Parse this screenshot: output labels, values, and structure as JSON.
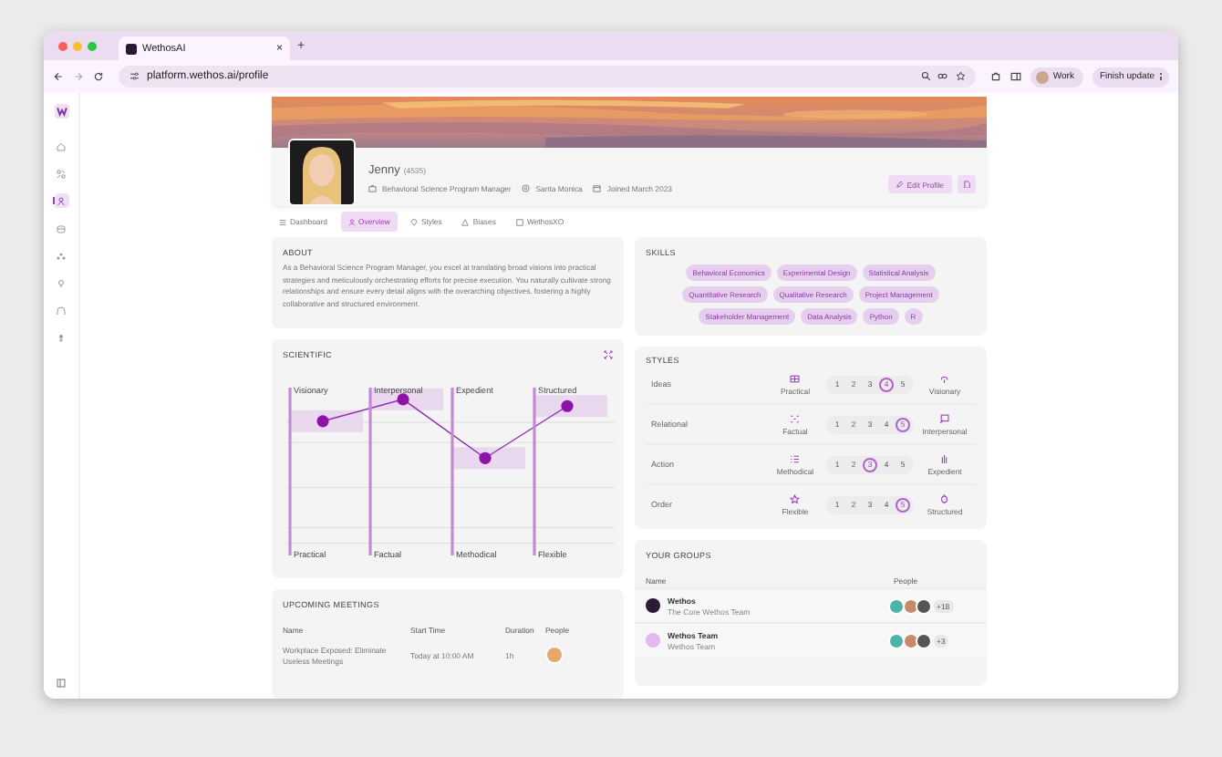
{
  "browser": {
    "tab_title": "WethosAI",
    "tab_close": "×",
    "new_tab": "+",
    "url": "platform.wethos.ai/profile",
    "profile_label": "Work",
    "update_button": "Finish update"
  },
  "sidebar": {
    "items": [
      {
        "selected": false
      },
      {
        "selected": false
      },
      {
        "selected": true
      },
      {
        "selected": false
      },
      {
        "selected": false
      },
      {
        "selected": false
      },
      {
        "selected": false
      },
      {
        "selected": false
      }
    ]
  },
  "profile": {
    "name": "Jenny",
    "handle": "(4535)",
    "title": "Behavioral Science Program Manager",
    "location": "Santa Monica",
    "joined": "Joined March 2023",
    "edit_button": "Edit Profile"
  },
  "tabs": [
    {
      "label": "Dashboard",
      "selected": false
    },
    {
      "label": "Overview",
      "selected": true
    },
    {
      "label": "Styles",
      "selected": false
    },
    {
      "label": "Biases",
      "selected": false
    },
    {
      "label": "WethosXO",
      "selected": false
    }
  ],
  "about": {
    "heading": "ABOUT",
    "text": "As a Behavioral Science Program Manager, you excel at translating broad visions into practical strategies and meticulously orchestrating efforts for precise execution. You naturally cultivate strong relationships and ensure every detail aligns with the overarching objectives, fostering a highly collaborative and structured environment."
  },
  "scientific": {
    "heading": "SCIENTIFIC",
    "axes": [
      {
        "top": "Visionary",
        "bottom": "Practical",
        "level": 0.8
      },
      {
        "top": "Interpersonal",
        "bottom": "Factual",
        "level": 0.93
      },
      {
        "top": "Expedient",
        "bottom": "Methodical",
        "level": 0.58
      },
      {
        "top": "Structured",
        "bottom": "Flexible",
        "level": 0.89
      }
    ]
  },
  "skills": {
    "heading": "SKILLS",
    "tags": [
      "Behavioral Economics",
      "Experimental Design",
      "Statistical Analysis",
      "Quantitative Research",
      "Qualitative Research",
      "Project Management",
      "Stakeholder Management",
      "Data Analysis",
      "Python",
      "R"
    ]
  },
  "styles": {
    "heading": "STYLES",
    "rows": [
      {
        "label": "Ideas",
        "left": "Practical",
        "right": "Visionary",
        "scale": [
          {
            "label": "1",
            "selected": false
          },
          {
            "label": "2",
            "selected": false
          },
          {
            "label": "3",
            "selected": false
          },
          {
            "label": "4",
            "selected": true
          },
          {
            "label": "5",
            "selected": false
          }
        ]
      },
      {
        "label": "Relational",
        "left": "Factual",
        "right": "Interpersonal",
        "scale": [
          {
            "label": "1",
            "selected": false
          },
          {
            "label": "2",
            "selected": false
          },
          {
            "label": "3",
            "selected": false
          },
          {
            "label": "4",
            "selected": false
          },
          {
            "label": "5",
            "selected": true
          }
        ]
      },
      {
        "label": "Action",
        "left": "Methodical",
        "right": "Expedient",
        "scale": [
          {
            "label": "1",
            "selected": false
          },
          {
            "label": "2",
            "selected": false
          },
          {
            "label": "3",
            "selected": true
          },
          {
            "label": "4",
            "selected": false
          },
          {
            "label": "5",
            "selected": false
          }
        ]
      },
      {
        "label": "Order",
        "left": "Flexible",
        "right": "Structured",
        "scale": [
          {
            "label": "1",
            "selected": false
          },
          {
            "label": "2",
            "selected": false
          },
          {
            "label": "3",
            "selected": false
          },
          {
            "label": "4",
            "selected": false
          },
          {
            "label": "5",
            "selected": true
          }
        ]
      }
    ]
  },
  "groups": {
    "heading": "YOUR GROUPS",
    "columns": [
      "Name",
      "People"
    ],
    "rows": [
      {
        "name": "Wethos",
        "subtitle": "The Core Wethos Team",
        "extra": "+18"
      },
      {
        "name": "Wethos Team",
        "subtitle": "Wethos Team",
        "extra": "+3"
      }
    ]
  },
  "meetings": {
    "heading": "UPCOMING MEETINGS",
    "columns": [
      "Name",
      "Start Time",
      "Duration",
      "People"
    ],
    "rows": [
      {
        "name": "Workplace Exposed: Eliminate Useless Meetings",
        "start": "Today at 10:00 AM",
        "duration": "1h"
      }
    ]
  }
}
